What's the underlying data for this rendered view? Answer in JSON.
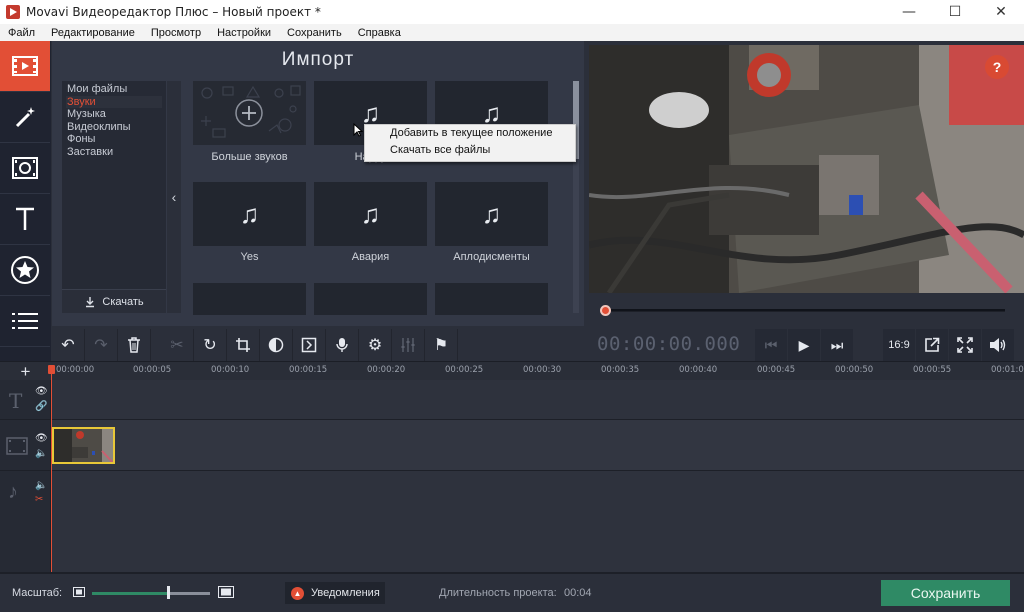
{
  "window": {
    "title": "Movavi Видеоредактор Плюс – Новый проект *",
    "min_glyph": "—",
    "max_glyph": "☐",
    "close_glyph": "✕"
  },
  "menu": [
    "Файл",
    "Редактирование",
    "Просмотр",
    "Настройки",
    "Сохранить",
    "Справка"
  ],
  "nav_icons": [
    "import-icon",
    "magic-wand-icon",
    "filters-film-icon",
    "titles-icon",
    "stickers-star-icon",
    "list-icon"
  ],
  "import": {
    "heading": "Импорт",
    "categories": [
      "Мои файлы",
      "Звуки",
      "Музыка",
      "Видеоклипы",
      "Фоны",
      "Заставки"
    ],
    "selected_category": "Звуки",
    "download_label": "Скачать",
    "tiles": [
      {
        "label": "Больше звуков"
      },
      {
        "label": "Happy"
      },
      {
        "label": ""
      },
      {
        "label": "Yes"
      },
      {
        "label": "Авария"
      },
      {
        "label": "Аплодисменты"
      }
    ]
  },
  "context_menu": {
    "items": [
      "Добавить в текущее положение",
      "Скачать все файлы"
    ]
  },
  "player": {
    "timecode": "00:00:00.000",
    "aspect": "16:9",
    "help": "?"
  },
  "timeline": {
    "ticks": [
      "00:00:00",
      "00:00:05",
      "00:00:10",
      "00:00:15",
      "00:00:20",
      "00:00:25",
      "00:00:30",
      "00:00:35",
      "00:00:40",
      "00:00:45",
      "00:00:50",
      "00:00:55",
      "00:01:0"
    ]
  },
  "status": {
    "scale_label": "Масштаб:",
    "scale_level": 0.64,
    "notifications": "Уведомления",
    "duration_label": "Длительность проекта:",
    "duration_value": "00:04",
    "save": "Сохранить"
  },
  "colors": {
    "accent": "#e24f36",
    "save_green": "#2f8a65",
    "clip_border": "#e8c838"
  }
}
